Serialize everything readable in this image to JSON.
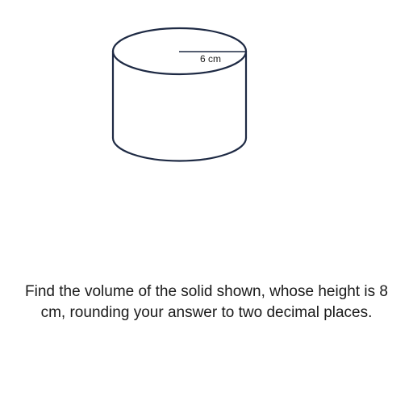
{
  "figure": {
    "radius_label": "6 cm",
    "stroke_color": "#1e2a44"
  },
  "question": {
    "text": "Find the volume of the solid shown, whose height is 8 cm, rounding your answer to two decimal places."
  }
}
